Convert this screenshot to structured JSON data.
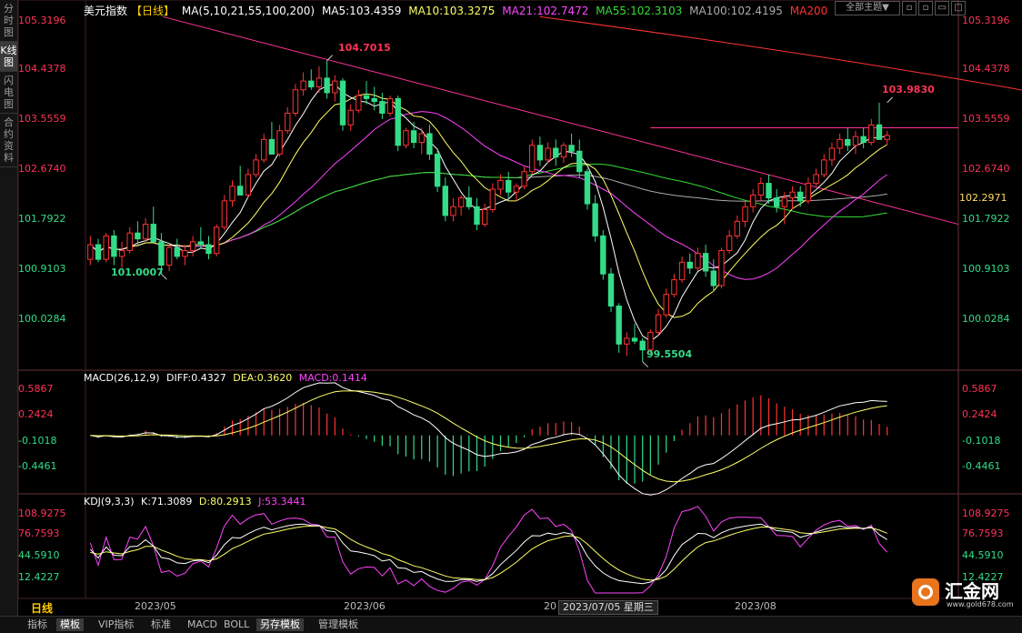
{
  "sidebar": {
    "tabs": [
      "分时图",
      "K线图",
      "闪电图",
      "合约资料"
    ],
    "active": 1
  },
  "top_right": {
    "selector": "全部主题▼"
  },
  "main_legend": {
    "title": "美元指数",
    "period": "【日线】",
    "ma_set": "MA(5,10,21,55,100,200)",
    "items": [
      {
        "label": "MA5:103.4359",
        "color": "#ffffff"
      },
      {
        "label": "MA10:103.3275",
        "color": "#ffff66"
      },
      {
        "label": "MA21:102.7472",
        "color": "#ff44ff"
      },
      {
        "label": "MA55:102.3103",
        "color": "#33dd33"
      },
      {
        "label": "MA100:102.4195",
        "color": "#aaaaaa"
      },
      {
        "label": "MA200",
        "color": "#ff3333"
      }
    ]
  },
  "main_yticks": [
    "105.3196",
    "104.4378",
    "103.5559",
    "102.6740",
    "101.7922",
    "100.9103",
    "100.0284"
  ],
  "main_right_label": "102.2971",
  "annotations": {
    "high": "104.7015",
    "low1": "101.0007",
    "low2": "99.5504",
    "recent_high": "103.9830"
  },
  "macd_legend": {
    "title": "MACD(26,12,9)",
    "diff": "DIFF:0.4327",
    "dea": "DEA:0.3620",
    "macd": "MACD:0.1414"
  },
  "macd_yticks": [
    "0.5867",
    "0.2424",
    "-0.1018",
    "-0.4461"
  ],
  "kdj_legend": {
    "title": "KDJ(9,3,3)",
    "k": "K:71.3089",
    "d": "D:80.2913",
    "j": "J:53.3441"
  },
  "kdj_yticks": [
    "108.9275",
    "76.7593",
    "44.5910",
    "12.4227"
  ],
  "x_axis": {
    "period_label": "日线",
    "labels": [
      "2023/05",
      "2023/06",
      "20",
      "2023/08"
    ],
    "tooltip": "2023/07/05 星期三"
  },
  "bottom_tabs": [
    "指标",
    "模板",
    "VIP指标",
    "标准",
    "MACD",
    "BOLL",
    "另存模板",
    "管理模板"
  ],
  "bottom_active": 1,
  "logo": {
    "name": "汇金网",
    "url": "www.gold678.com"
  },
  "colors": {
    "up": "#ff3333",
    "down": "#33dd88",
    "ma5": "#ffffff",
    "ma10": "#ffff66",
    "ma21": "#ff44ff",
    "ma55": "#33dd33",
    "ma100": "#aaaaaa",
    "ma200": "#ff3333",
    "trend": "#ff3399"
  },
  "chart_data": {
    "type": "candlestick",
    "series_count": 150,
    "candles": [
      [
        101.3,
        101.7,
        101.2,
        101.55
      ],
      [
        101.55,
        101.65,
        101.25,
        101.3
      ],
      [
        101.3,
        101.75,
        101.25,
        101.7
      ],
      [
        101.7,
        101.8,
        101.2,
        101.35
      ],
      [
        101.35,
        101.6,
        101.15,
        101.45
      ],
      [
        101.45,
        101.85,
        101.4,
        101.75
      ],
      [
        101.75,
        101.95,
        101.55,
        101.65
      ],
      [
        101.65,
        102.0,
        101.6,
        101.9
      ],
      [
        101.9,
        102.2,
        101.8,
        101.6
      ],
      [
        101.6,
        101.75,
        101.05,
        101.2
      ],
      [
        101.2,
        101.55,
        101.1,
        101.5
      ],
      [
        101.5,
        101.65,
        101.3,
        101.35
      ],
      [
        101.35,
        101.55,
        101.2,
        101.45
      ],
      [
        101.45,
        101.7,
        101.35,
        101.6
      ],
      [
        101.6,
        101.85,
        101.5,
        101.55
      ],
      [
        101.55,
        101.7,
        101.3,
        101.4
      ],
      [
        101.4,
        101.9,
        101.35,
        101.85
      ],
      [
        101.85,
        102.4,
        101.8,
        102.3
      ],
      [
        102.3,
        102.65,
        102.2,
        102.55
      ],
      [
        102.55,
        102.9,
        102.45,
        102.4
      ],
      [
        102.4,
        102.85,
        102.35,
        102.75
      ],
      [
        102.75,
        103.1,
        102.7,
        103.0
      ],
      [
        103.0,
        103.45,
        102.95,
        103.35
      ],
      [
        103.35,
        103.65,
        103.25,
        103.1
      ],
      [
        103.1,
        103.6,
        103.05,
        103.5
      ],
      [
        103.5,
        103.9,
        103.45,
        103.8
      ],
      [
        103.8,
        104.3,
        103.75,
        104.2
      ],
      [
        104.2,
        104.5,
        104.1,
        104.35
      ],
      [
        104.35,
        104.55,
        104.2,
        104.25
      ],
      [
        104.25,
        104.6,
        104.15,
        104.4
      ],
      [
        104.4,
        104.7,
        104.05,
        104.15
      ],
      [
        104.15,
        104.45,
        104.0,
        104.35
      ],
      [
        104.35,
        104.4,
        103.5,
        103.6
      ],
      [
        103.6,
        103.95,
        103.5,
        103.85
      ],
      [
        103.85,
        104.2,
        103.8,
        104.1
      ],
      [
        104.1,
        104.35,
        103.95,
        104.05
      ],
      [
        104.05,
        104.25,
        103.85,
        104.0
      ],
      [
        104.0,
        104.15,
        103.7,
        103.8
      ],
      [
        103.8,
        104.1,
        103.75,
        104.05
      ],
      [
        104.05,
        104.1,
        103.15,
        103.25
      ],
      [
        103.25,
        103.55,
        103.2,
        103.5
      ],
      [
        103.5,
        103.65,
        103.2,
        103.3
      ],
      [
        103.3,
        103.55,
        103.1,
        103.45
      ],
      [
        103.45,
        103.6,
        103.0,
        103.1
      ],
      [
        103.1,
        103.2,
        102.45,
        102.55
      ],
      [
        102.55,
        102.7,
        101.95,
        102.05
      ],
      [
        102.05,
        102.35,
        101.95,
        102.2
      ],
      [
        102.2,
        102.4,
        102.05,
        102.35
      ],
      [
        102.35,
        102.55,
        102.15,
        102.2
      ],
      [
        102.2,
        102.35,
        101.8,
        101.9
      ],
      [
        101.9,
        102.25,
        101.85,
        102.15
      ],
      [
        102.15,
        102.6,
        102.1,
        102.5
      ],
      [
        102.5,
        102.75,
        102.4,
        102.65
      ],
      [
        102.65,
        102.8,
        102.35,
        102.45
      ],
      [
        102.45,
        102.6,
        102.3,
        102.55
      ],
      [
        102.55,
        102.9,
        102.5,
        102.8
      ],
      [
        102.8,
        103.35,
        102.75,
        103.25
      ],
      [
        103.25,
        103.4,
        102.9,
        103.0
      ],
      [
        103.0,
        103.3,
        102.95,
        103.2
      ],
      [
        103.2,
        103.35,
        102.9,
        103.05
      ],
      [
        103.05,
        103.3,
        102.95,
        103.25
      ],
      [
        103.25,
        103.45,
        103.05,
        103.15
      ],
      [
        103.15,
        103.35,
        102.7,
        102.8
      ],
      [
        102.8,
        102.85,
        102.15,
        102.25
      ],
      [
        102.25,
        102.4,
        101.6,
        101.7
      ],
      [
        101.7,
        101.8,
        100.95,
        101.05
      ],
      [
        101.05,
        101.15,
        100.4,
        100.5
      ],
      [
        100.5,
        100.55,
        99.7,
        99.85
      ],
      [
        99.85,
        100.05,
        99.65,
        99.95
      ],
      [
        99.95,
        100.2,
        99.85,
        99.9
      ],
      [
        99.9,
        99.95,
        99.55,
        99.75
      ],
      [
        99.75,
        100.1,
        99.7,
        100.05
      ],
      [
        100.05,
        100.45,
        100.0,
        100.35
      ],
      [
        100.35,
        100.8,
        100.3,
        100.7
      ],
      [
        100.7,
        101.05,
        100.65,
        100.95
      ],
      [
        100.95,
        101.35,
        100.9,
        101.25
      ],
      [
        101.25,
        101.4,
        101.05,
        101.15
      ],
      [
        101.15,
        101.5,
        101.1,
        101.4
      ],
      [
        101.4,
        101.55,
        101.0,
        101.1
      ],
      [
        101.1,
        101.3,
        100.75,
        100.85
      ],
      [
        100.85,
        101.5,
        100.8,
        101.45
      ],
      [
        101.45,
        101.8,
        101.4,
        101.7
      ],
      [
        101.7,
        102.05,
        101.65,
        101.95
      ],
      [
        101.95,
        102.3,
        101.85,
        102.2
      ],
      [
        102.2,
        102.5,
        102.1,
        102.4
      ],
      [
        102.4,
        102.7,
        102.3,
        102.6
      ],
      [
        102.6,
        102.75,
        102.25,
        102.35
      ],
      [
        102.35,
        102.5,
        102.1,
        102.2
      ],
      [
        102.2,
        102.45,
        101.9,
        102.35
      ],
      [
        102.35,
        102.55,
        102.15,
        102.45
      ],
      [
        102.45,
        102.55,
        102.2,
        102.3
      ],
      [
        102.3,
        102.7,
        102.25,
        102.6
      ],
      [
        102.6,
        102.85,
        102.55,
        102.75
      ],
      [
        102.75,
        103.1,
        102.7,
        103.0
      ],
      [
        103.0,
        103.3,
        102.9,
        103.2
      ],
      [
        103.2,
        103.45,
        103.1,
        103.35
      ],
      [
        103.35,
        103.55,
        103.15,
        103.25
      ],
      [
        103.25,
        103.5,
        103.1,
        103.4
      ],
      [
        103.4,
        103.55,
        103.2,
        103.3
      ],
      [
        103.3,
        103.7,
        103.25,
        103.6
      ],
      [
        103.6,
        103.98,
        103.55,
        103.35
      ],
      [
        103.35,
        103.5,
        103.25,
        103.42
      ]
    ],
    "ylim_main": [
      99.45,
      105.55
    ],
    "macd_ylim": [
      -0.75,
      0.78
    ],
    "kdj_ylim": [
      -5,
      122
    ]
  }
}
